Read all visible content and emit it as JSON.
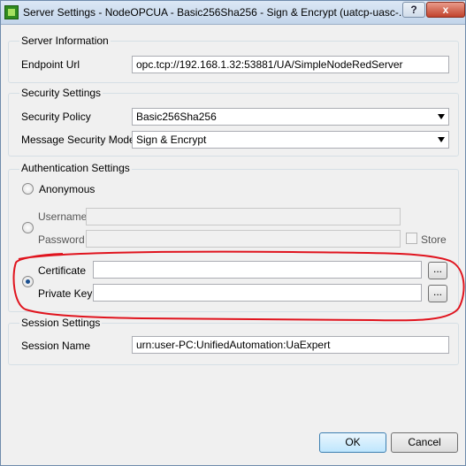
{
  "window": {
    "title": "Server Settings - NodeOPCUA - Basic256Sha256 - Sign & Encrypt (uatcp-uasc-...",
    "help_label": "?",
    "close_label": "x"
  },
  "server_info": {
    "group_title": "Server Information",
    "endpoint_label": "Endpoint Url",
    "endpoint_value": "opc.tcp://192.168.1.32:53881/UA/SimpleNodeRedServer"
  },
  "security": {
    "group_title": "Security Settings",
    "policy_label": "Security Policy",
    "policy_value": "Basic256Sha256",
    "mode_label": "Message Security Mode",
    "mode_value": "Sign & Encrypt"
  },
  "auth": {
    "group_title": "Authentication Settings",
    "anonymous_label": "Anonymous",
    "username_label": "Username",
    "username_value": "",
    "password_label": "Password",
    "password_value": "",
    "store_label": "Store",
    "certificate_label": "Certificate",
    "certificate_value": "",
    "private_key_label": "Private Key",
    "private_key_value": "",
    "browse_label": "...",
    "selected_option": "certificate"
  },
  "session": {
    "group_title": "Session Settings",
    "name_label": "Session Name",
    "name_value": "urn:user-PC:UnifiedAutomation:UaExpert"
  },
  "buttons": {
    "ok_label": "OK",
    "cancel_label": "Cancel"
  },
  "colors": {
    "annotation": "#e0141e",
    "titlebar": "#c3d5ea"
  }
}
